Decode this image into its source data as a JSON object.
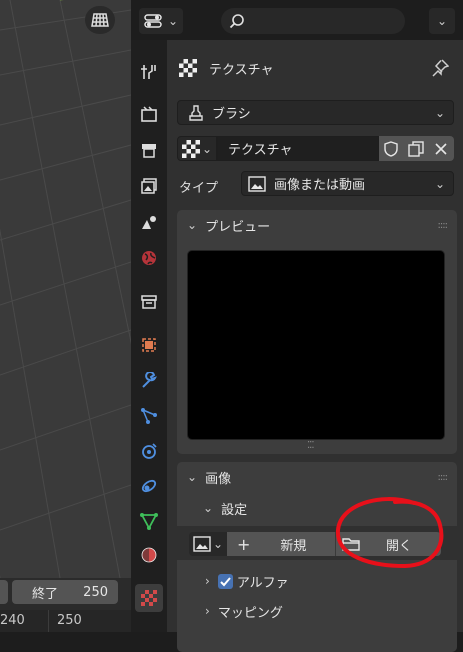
{
  "timeline": {
    "end_label": "終了",
    "end_value": "250",
    "ruler_ticks": [
      "240",
      "250"
    ]
  },
  "header": {
    "editor_type_icon": "properties-editor-icon",
    "search_placeholder": "",
    "options_icon": "chevron-down-icon"
  },
  "panel": {
    "title": "テクスチャ",
    "context_dropdown": "ブラシ",
    "texture_name": "テクスチャ",
    "type_label": "タイプ",
    "type_value": "画像または動画",
    "preview_title": "プレビュー",
    "image_title": "画像",
    "settings_title": "設定",
    "new_label": "新規",
    "open_label": "開く",
    "alpha_label": "アルファ",
    "alpha_checked": true,
    "mapping_label": "マッピング"
  },
  "tabs": [
    "tool-tab-icon",
    "render-tab-icon",
    "output-tab-icon",
    "view-layer-tab-icon",
    "scene-tab-icon",
    "world-tab-icon",
    "collection-tab-icon",
    "object-tab-icon",
    "modifier-tab-icon",
    "particles-tab-icon",
    "physics-tab-icon",
    "constraints-tab-icon",
    "data-tab-icon",
    "material-tab-icon",
    "texture-tab-icon"
  ],
  "colors": {
    "accent_blue": "#4772b3",
    "annotation_red": "#e8101a"
  }
}
